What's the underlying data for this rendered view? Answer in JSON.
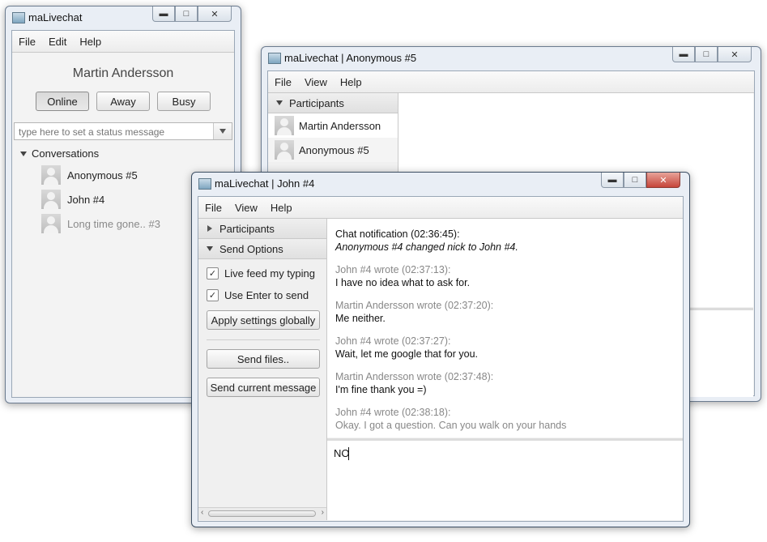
{
  "win1": {
    "title": "maLivechat",
    "menu": [
      "File",
      "Edit",
      "Help"
    ],
    "user_name": "Martin Andersson",
    "status_buttons": {
      "online": "Online",
      "away": "Away",
      "busy": "Busy"
    },
    "status_placeholder": "type here to set a status message",
    "conversations_header": "Conversations",
    "conversations": [
      {
        "name": "Anonymous #5",
        "active": true
      },
      {
        "name": "John #4",
        "active": true
      },
      {
        "name": "Long time gone.. #3",
        "active": false
      }
    ]
  },
  "win2": {
    "title": "maLivechat | Anonymous #5",
    "menu": [
      "File",
      "View",
      "Help"
    ],
    "participants_header": "Participants",
    "participants": [
      "Martin Andersson",
      "Anonymous #5"
    ]
  },
  "win3": {
    "title": "maLivechat | John #4",
    "menu": [
      "File",
      "View",
      "Help"
    ],
    "participants_header": "Participants",
    "send_options_header": "Send Options",
    "options": {
      "live_feed": {
        "label": "Live feed my typing",
        "checked": true
      },
      "use_enter": {
        "label": "Use Enter to send",
        "checked": true
      }
    },
    "apply_globally_label": "Apply settings globally",
    "send_files_label": "Send files..",
    "send_current_label": "Send current message",
    "messages": [
      {
        "header": "Chat notification (02:36:45):",
        "body": "Anonymous #4 changed nick to John #4.",
        "notification": true
      },
      {
        "header": "John #4 wrote (02:37:13):",
        "body": "I have no idea what to ask for."
      },
      {
        "header": "Martin Andersson wrote (02:37:20):",
        "body": "Me neither."
      },
      {
        "header": "John #4 wrote (02:37:27):",
        "body": "Wait, let me google that for you."
      },
      {
        "header": "Martin Andersson wrote (02:37:48):",
        "body": "I'm fine thank you =)"
      },
      {
        "header": "John #4 wrote (02:38:18):",
        "body": "Okay. I got a question. Can you walk on your hands",
        "faded": true
      }
    ],
    "input_value": "NO"
  },
  "colors": {
    "window_frame": "#e9eef5",
    "accent_close": "#c6453a",
    "muted_text": "#888888"
  }
}
